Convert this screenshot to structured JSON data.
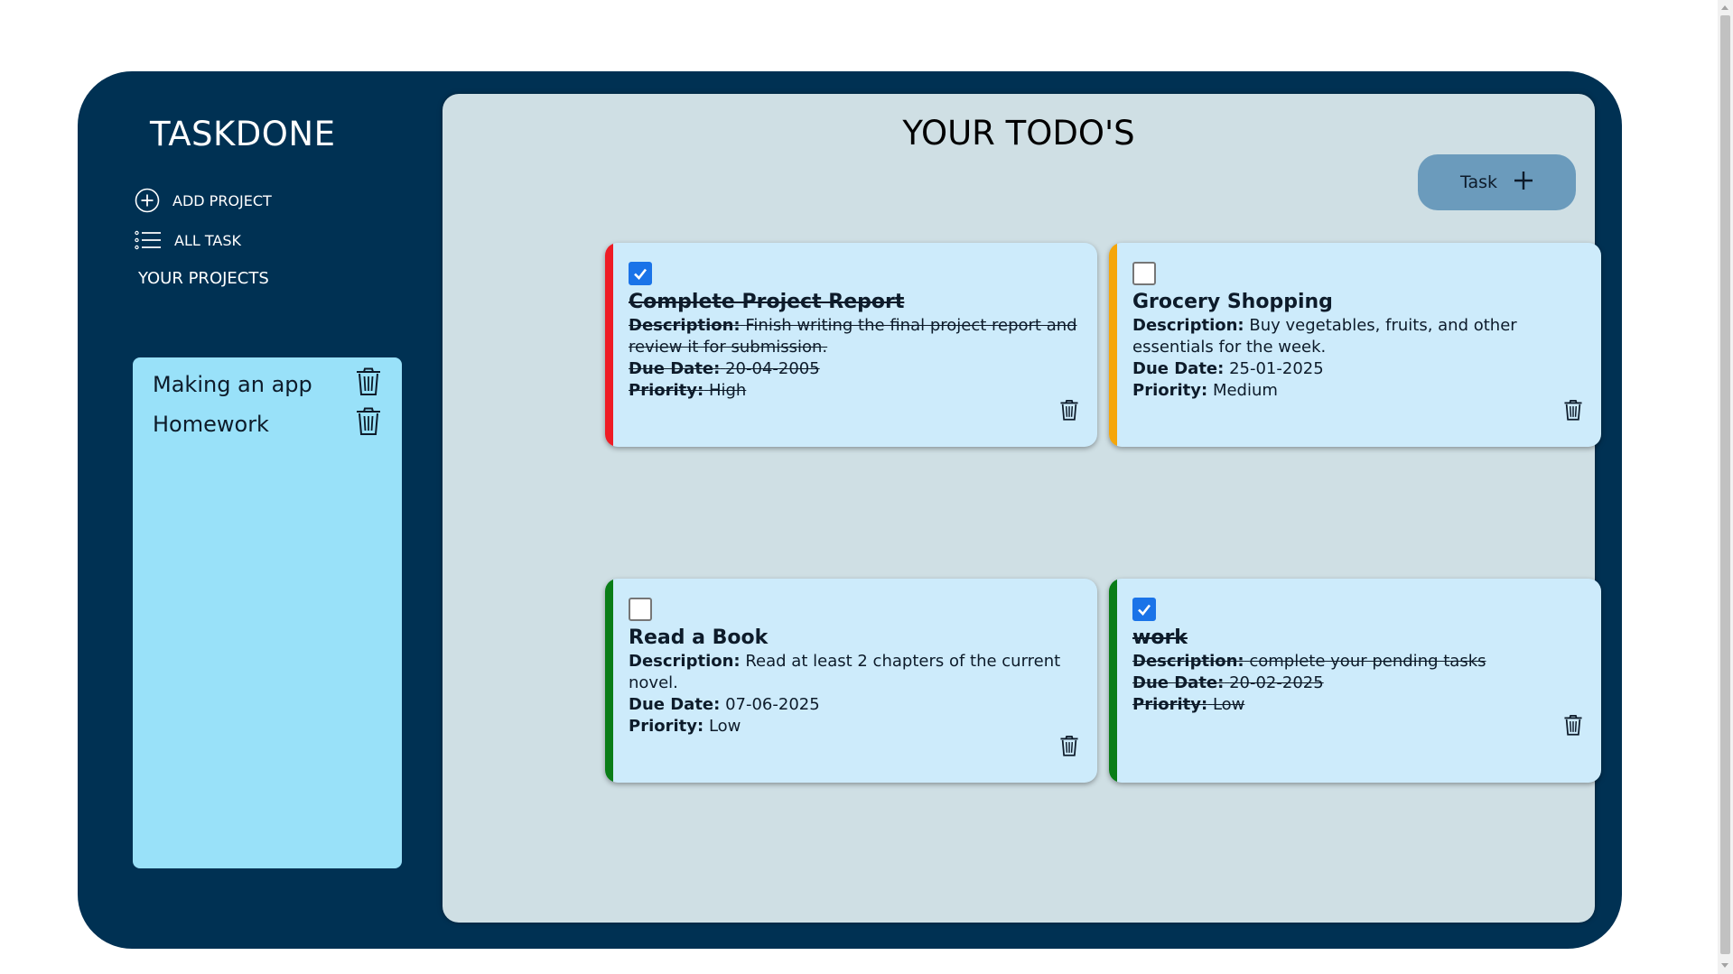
{
  "app": {
    "title": "TASKDONE"
  },
  "sidebar": {
    "add_project_label": "ADD PROJECT",
    "all_task_label": "ALL TASK",
    "projects_heading": "YOUR PROJECTS",
    "projects": [
      {
        "name": "Making an app"
      },
      {
        "name": "Homework"
      }
    ]
  },
  "main": {
    "title": "YOUR TODO'S",
    "add_task_label": "Task"
  },
  "labels": {
    "description": "Description:",
    "due_date": "Due Date:",
    "priority": "Priority:"
  },
  "tasks": [
    {
      "title": "Complete Project Report",
      "description": "Finish writing the final project report and review it for submission.",
      "due_date": "20-04-2005",
      "priority": "High",
      "completed": true,
      "priority_color": "#ee1c25"
    },
    {
      "title": "Grocery Shopping",
      "description": "Buy vegetables, fruits, and other essentials for the week.",
      "due_date": "25-01-2025",
      "priority": "Medium",
      "completed": false,
      "priority_color": "#f5a60a"
    },
    {
      "title": "Read a Book",
      "description": "Read at least 2 chapters of the current novel.",
      "due_date": "07-06-2025",
      "priority": "Low",
      "completed": false,
      "priority_color": "#0a7d17"
    },
    {
      "title": "work",
      "description": "complete your pending tasks",
      "due_date": "20-02-2025",
      "priority": "Low",
      "completed": true,
      "priority_color": "#0a7d17"
    }
  ],
  "colors": {
    "shell": "#003153",
    "main_panel": "#cfdfe4",
    "project_panel": "#99e1f9",
    "card": "#cdebfb",
    "add_task_button": "#6b9bbc",
    "checkbox_on": "#1a73e8"
  },
  "icons": {
    "add_project": "plus-circle-icon",
    "all_task": "list-icon",
    "delete": "trash-icon",
    "add_task": "plus-icon",
    "checked": "checkmark-icon"
  }
}
